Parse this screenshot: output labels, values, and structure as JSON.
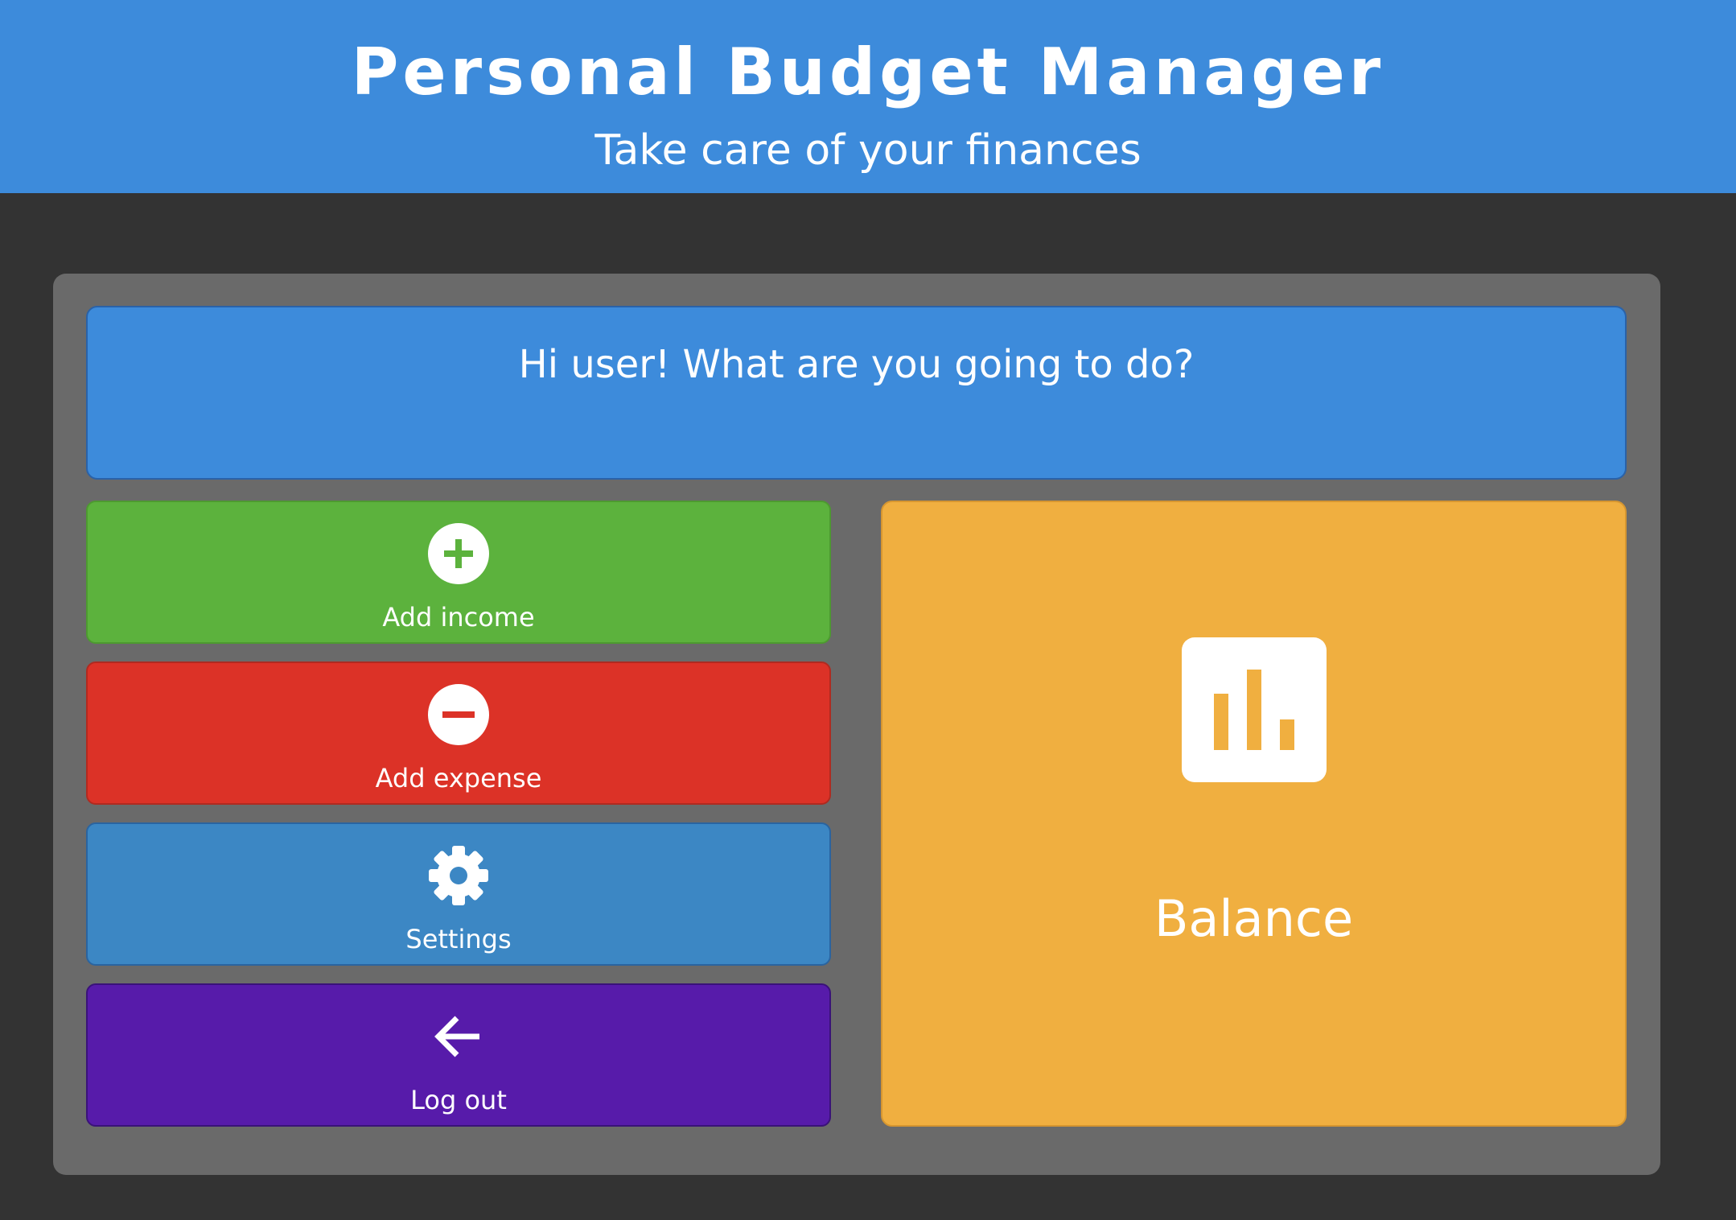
{
  "header": {
    "title": "Personal Budget Manager",
    "subtitle": "Take care of your finances"
  },
  "greeting": {
    "text": "Hi user! What are you going to do?"
  },
  "actions": [
    {
      "label": "Add income",
      "icon": "plus-circle-icon",
      "color": "#5cb23d"
    },
    {
      "label": "Add expense",
      "icon": "minus-circle-icon",
      "color": "#dc3227"
    },
    {
      "label": "Settings",
      "icon": "gear-icon",
      "color": "#3c87c4"
    },
    {
      "label": "Log out",
      "icon": "arrow-left-icon",
      "color": "#571baa"
    }
  ],
  "balance": {
    "label": "Balance",
    "icon": "bar-chart-icon",
    "color": "#f0af40"
  },
  "colors": {
    "header_bg": "#3d8bdb",
    "page_bg": "#333333",
    "panel_bg": "#6a6a6a"
  }
}
